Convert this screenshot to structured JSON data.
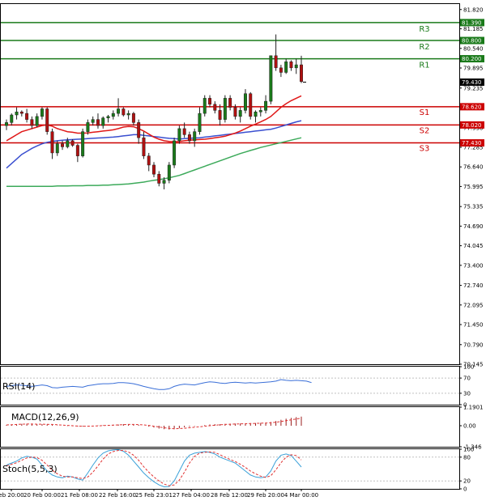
{
  "chart_data": {
    "type": "candlestick",
    "main": {
      "y_ticks": [
        "81.820",
        "81.185",
        "80.540",
        "79.895",
        "79.235",
        "78.590",
        "77.930",
        "77.285",
        "76.640",
        "75.995",
        "75.335",
        "74.690",
        "74.045",
        "73.400",
        "72.740",
        "72.095",
        "71.450",
        "70.790",
        "70.145"
      ],
      "ylim": [
        70.145,
        82.0
      ],
      "current_price": "79.430",
      "levels": [
        {
          "name": "R3",
          "value": 81.39,
          "tag": "81.390",
          "color": "#1a7a1a"
        },
        {
          "name": "R2",
          "value": 80.8,
          "tag": "80.800",
          "color": "#1a7a1a"
        },
        {
          "name": "R1",
          "value": 80.2,
          "tag": "80.200",
          "color": "#1a7a1a"
        },
        {
          "name": "S1",
          "value": 78.62,
          "tag": "78.620",
          "color": "#cc0000"
        },
        {
          "name": "S2",
          "value": 78.02,
          "tag": "78.020",
          "color": "#cc0000"
        },
        {
          "name": "S3",
          "value": 77.43,
          "tag": "77.430",
          "color": "#cc0000"
        }
      ],
      "candles": [
        [
          78.0,
          78.2,
          77.85,
          78.1
        ],
        [
          78.1,
          78.4,
          78.0,
          78.35
        ],
        [
          78.35,
          78.6,
          78.2,
          78.45
        ],
        [
          78.45,
          78.5,
          78.3,
          78.4
        ],
        [
          78.4,
          78.55,
          78.1,
          78.2
        ],
        [
          78.2,
          78.3,
          77.9,
          78.0
        ],
        [
          78.0,
          78.4,
          77.95,
          78.3
        ],
        [
          78.3,
          78.6,
          78.2,
          78.55
        ],
        [
          78.55,
          78.6,
          77.7,
          77.8
        ],
        [
          77.8,
          77.9,
          76.9,
          77.1
        ],
        [
          77.1,
          77.5,
          77.0,
          77.4
        ],
        [
          77.4,
          77.5,
          77.2,
          77.3
        ],
        [
          77.3,
          77.6,
          77.25,
          77.5
        ],
        [
          77.5,
          77.55,
          77.3,
          77.35
        ],
        [
          77.35,
          77.4,
          76.8,
          77.0
        ],
        [
          77.0,
          77.9,
          76.95,
          77.8
        ],
        [
          77.8,
          78.2,
          77.7,
          78.1
        ],
        [
          78.1,
          78.3,
          78.0,
          78.2
        ],
        [
          78.2,
          78.4,
          77.9,
          78.0
        ],
        [
          78.0,
          78.3,
          77.9,
          78.25
        ],
        [
          78.25,
          78.35,
          78.1,
          78.3
        ],
        [
          78.3,
          78.5,
          78.2,
          78.4
        ],
        [
          78.4,
          78.9,
          78.3,
          78.55
        ],
        [
          78.55,
          78.6,
          78.3,
          78.35
        ],
        [
          78.35,
          78.5,
          78.2,
          78.4
        ],
        [
          78.4,
          78.45,
          78.0,
          78.1
        ],
        [
          78.1,
          78.2,
          77.4,
          77.6
        ],
        [
          77.6,
          77.8,
          76.9,
          77.0
        ],
        [
          77.0,
          77.1,
          76.5,
          76.7
        ],
        [
          76.7,
          76.8,
          76.3,
          76.4
        ],
        [
          76.4,
          76.5,
          76.0,
          76.1
        ],
        [
          76.1,
          76.3,
          75.9,
          76.2
        ],
        [
          76.2,
          76.8,
          76.1,
          76.7
        ],
        [
          76.7,
          77.6,
          76.6,
          77.5
        ],
        [
          77.5,
          78.0,
          77.4,
          77.9
        ],
        [
          77.9,
          78.1,
          77.6,
          77.7
        ],
        [
          77.7,
          77.8,
          77.4,
          77.5
        ],
        [
          77.5,
          77.9,
          77.3,
          77.8
        ],
        [
          77.8,
          78.6,
          77.7,
          78.4
        ],
        [
          78.4,
          79.0,
          78.3,
          78.9
        ],
        [
          78.9,
          79.0,
          78.6,
          78.7
        ],
        [
          78.7,
          78.8,
          78.4,
          78.5
        ],
        [
          78.5,
          78.7,
          78.0,
          78.2
        ],
        [
          78.2,
          79.0,
          78.1,
          78.9
        ],
        [
          78.9,
          79.0,
          78.5,
          78.6
        ],
        [
          78.6,
          78.7,
          78.2,
          78.3
        ],
        [
          78.3,
          78.6,
          78.1,
          78.5
        ],
        [
          78.5,
          79.2,
          78.4,
          79.05
        ],
        [
          79.05,
          79.1,
          78.2,
          78.3
        ],
        [
          78.3,
          78.5,
          78.1,
          78.45
        ],
        [
          78.45,
          78.6,
          78.3,
          78.5
        ],
        [
          78.5,
          79.0,
          78.4,
          78.8
        ],
        [
          78.8,
          80.3,
          78.7,
          80.3
        ],
        [
          80.3,
          81.0,
          79.8,
          79.9
        ],
        [
          79.9,
          80.0,
          79.6,
          79.75
        ],
        [
          79.75,
          80.2,
          79.7,
          80.1
        ],
        [
          80.1,
          80.15,
          79.8,
          79.9
        ],
        [
          79.9,
          80.2,
          79.7,
          80.0
        ],
        [
          80.0,
          80.3,
          79.4,
          79.45
        ]
      ],
      "ma_fast": [
        77.5,
        77.6,
        77.7,
        77.8,
        77.85,
        77.9,
        77.95,
        78.0,
        78.02,
        77.98,
        77.9,
        77.85,
        77.8,
        77.78,
        77.75,
        77.75,
        77.76,
        77.78,
        77.8,
        77.82,
        77.84,
        77.86,
        77.9,
        77.95,
        77.97,
        77.96,
        77.9,
        77.82,
        77.72,
        77.62,
        77.55,
        77.5,
        77.48,
        77.47,
        77.48,
        77.5,
        77.52,
        77.53,
        77.54,
        77.55,
        77.57,
        77.6,
        77.62,
        77.65,
        77.7,
        77.75,
        77.82,
        77.9,
        77.98,
        78.05,
        78.12,
        78.2,
        78.3,
        78.45,
        78.6,
        78.72,
        78.82,
        78.9,
        78.98
      ],
      "ma_mid": [
        76.6,
        76.75,
        76.9,
        77.05,
        77.15,
        77.25,
        77.33,
        77.4,
        77.45,
        77.48,
        77.5,
        77.52,
        77.53,
        77.54,
        77.55,
        77.56,
        77.57,
        77.58,
        77.59,
        77.6,
        77.61,
        77.62,
        77.64,
        77.66,
        77.68,
        77.7,
        77.7,
        77.68,
        77.66,
        77.64,
        77.62,
        77.6,
        77.58,
        77.57,
        77.56,
        77.57,
        77.58,
        77.59,
        77.6,
        77.62,
        77.64,
        77.66,
        77.68,
        77.7,
        77.72,
        77.74,
        77.76,
        77.78,
        77.8,
        77.82,
        77.84,
        77.86,
        77.88,
        77.92,
        77.97,
        78.02,
        78.07,
        78.12,
        78.16
      ],
      "ma_slow": [
        76.0,
        76.0,
        76.0,
        76.0,
        76.0,
        76.0,
        76.0,
        76.0,
        76.0,
        76.0,
        76.01,
        76.01,
        76.01,
        76.02,
        76.02,
        76.02,
        76.03,
        76.03,
        76.03,
        76.04,
        76.04,
        76.05,
        76.06,
        76.07,
        76.08,
        76.1,
        76.12,
        76.14,
        76.17,
        76.2,
        76.22,
        76.25,
        76.28,
        76.32,
        76.36,
        76.42,
        76.48,
        76.54,
        76.6,
        76.66,
        76.72,
        76.78,
        76.84,
        76.9,
        76.96,
        77.02,
        77.08,
        77.13,
        77.18,
        77.23,
        77.28,
        77.32,
        77.36,
        77.4,
        77.44,
        77.48,
        77.52,
        77.56,
        77.6
      ]
    },
    "rsi": {
      "label": "RSI(14)",
      "y_ticks": [
        "100",
        "70",
        "30",
        "0"
      ],
      "ylim": [
        0,
        100
      ],
      "values": [
        48,
        50,
        52,
        51,
        50,
        48,
        50,
        52,
        50,
        45,
        44,
        46,
        47,
        48,
        47,
        46,
        50,
        52,
        54,
        55,
        55,
        56,
        58,
        58,
        57,
        55,
        52,
        48,
        45,
        42,
        40,
        40,
        42,
        48,
        52,
        54,
        53,
        52,
        55,
        58,
        60,
        59,
        57,
        56,
        58,
        59,
        58,
        57,
        58,
        57,
        58,
        59,
        60,
        62,
        66,
        64,
        63,
        64,
        63,
        62,
        58
      ],
      "color": "#3a6fd8"
    },
    "macd": {
      "label": "MACD(12,26,9)",
      "y_ticks": [
        "1.1901",
        "0.00",
        "-1.346"
      ],
      "ylim": [
        -1.346,
        1.1901
      ],
      "hist": [
        0.05,
        0.08,
        0.1,
        0.12,
        0.13,
        0.12,
        0.1,
        0.1,
        0.09,
        0.05,
        0.02,
        0.0,
        -0.02,
        -0.03,
        -0.05,
        -0.05,
        -0.03,
        -0.01,
        0.02,
        0.03,
        0.05,
        0.06,
        0.08,
        0.1,
        0.1,
        0.08,
        0.05,
        0.0,
        -0.06,
        -0.12,
        -0.18,
        -0.22,
        -0.24,
        -0.22,
        -0.16,
        -0.1,
        -0.06,
        -0.03,
        0.0,
        0.04,
        0.08,
        0.1,
        0.1,
        0.12,
        0.13,
        0.14,
        0.14,
        0.15,
        0.16,
        0.17,
        0.18,
        0.2,
        0.24,
        0.3,
        0.38,
        0.45,
        0.5,
        0.55,
        0.58
      ],
      "signal": [
        0.05,
        0.06,
        0.08,
        0.1,
        0.11,
        0.11,
        0.1,
        0.1,
        0.09,
        0.08,
        0.06,
        0.04,
        0.02,
        0.0,
        -0.02,
        -0.03,
        -0.03,
        -0.02,
        -0.01,
        0.01,
        0.02,
        0.04,
        0.05,
        0.07,
        0.08,
        0.08,
        0.07,
        0.05,
        0.02,
        -0.03,
        -0.08,
        -0.13,
        -0.17,
        -0.19,
        -0.18,
        -0.16,
        -0.13,
        -0.1,
        -0.07,
        -0.03,
        0.0,
        0.03,
        0.06,
        0.08,
        0.1,
        0.11,
        0.12,
        0.13,
        0.14,
        0.15,
        0.16,
        0.17,
        0.19,
        0.22,
        0.27,
        0.32,
        0.38,
        0.43,
        0.48
      ],
      "hist_color": "#9a1c1c",
      "signal_color": "#e03030"
    },
    "stoch": {
      "label": "Stoch(5,5,3)",
      "y_ticks": [
        "100",
        "80",
        "20",
        "0"
      ],
      "ylim": [
        0,
        100
      ],
      "k": [
        60,
        65,
        70,
        78,
        82,
        80,
        75,
        60,
        45,
        35,
        30,
        28,
        32,
        30,
        25,
        22,
        40,
        60,
        78,
        90,
        96,
        98,
        99,
        95,
        85,
        70,
        55,
        40,
        28,
        18,
        10,
        5,
        6,
        20,
        45,
        70,
        85,
        90,
        92,
        94,
        92,
        88,
        80,
        75,
        70,
        65,
        55,
        45,
        35,
        30,
        28,
        30,
        45,
        70,
        85,
        88,
        84,
        70,
        55
      ],
      "d": [
        58,
        62,
        66,
        72,
        78,
        80,
        79,
        72,
        60,
        47,
        38,
        32,
        30,
        30,
        28,
        26,
        30,
        42,
        58,
        75,
        88,
        94,
        97,
        97,
        93,
        85,
        72,
        56,
        42,
        30,
        20,
        12,
        8,
        10,
        22,
        42,
        65,
        82,
        90,
        92,
        93,
        92,
        86,
        80,
        74,
        69,
        62,
        54,
        45,
        38,
        32,
        29,
        33,
        48,
        66,
        80,
        86,
        84,
        73
      ],
      "k_color": "#3aa0d8",
      "d_color": "#e03030"
    },
    "x_ticks": [
      "eb 20:00",
      "20 Feb 00:00",
      "21 Feb 08:00",
      "22 Feb 16:00",
      "25 Feb 23:01",
      "27 Feb 04:00",
      "28 Feb 12:00",
      "29 Feb 20:00",
      "4 Mar 00:00"
    ]
  }
}
